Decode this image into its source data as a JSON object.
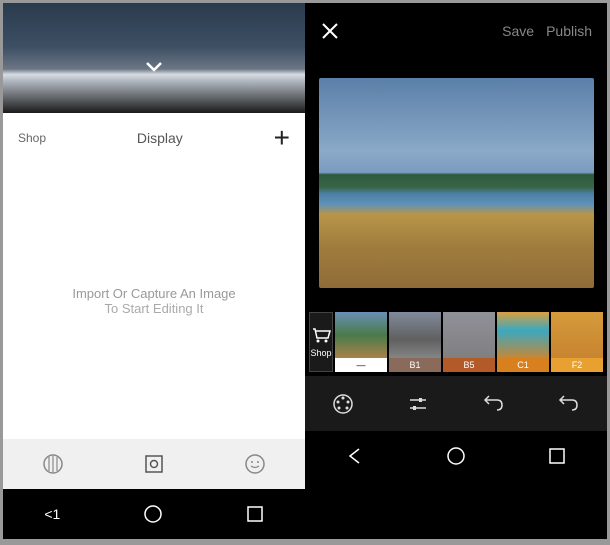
{
  "left": {
    "header": {
      "shop": "Shop",
      "title": "Display",
      "addIcon": "+"
    },
    "empty": {
      "line1": "Import Or Capture An Image",
      "line2": "To Start Editing It"
    },
    "nav": {
      "backLabel": "<1"
    }
  },
  "right": {
    "header": {
      "save": "Save",
      "publish": "Publish"
    },
    "filters": {
      "shopLabel": "Shop",
      "items": [
        {
          "name": "—",
          "bg": "#fff",
          "fg": "#000",
          "cls": "f-orig"
        },
        {
          "name": "B1",
          "bg": "#8a6a5a",
          "fg": "#fff",
          "cls": "f-b1"
        },
        {
          "name": "B5",
          "bg": "#b25a28",
          "fg": "#fff",
          "cls": "f-b5"
        },
        {
          "name": "C1",
          "bg": "#d8801e",
          "fg": "#fff",
          "cls": "f-c1"
        },
        {
          "name": "F2",
          "bg": "#e8a030",
          "fg": "#fff",
          "cls": "f-f2"
        }
      ]
    }
  }
}
